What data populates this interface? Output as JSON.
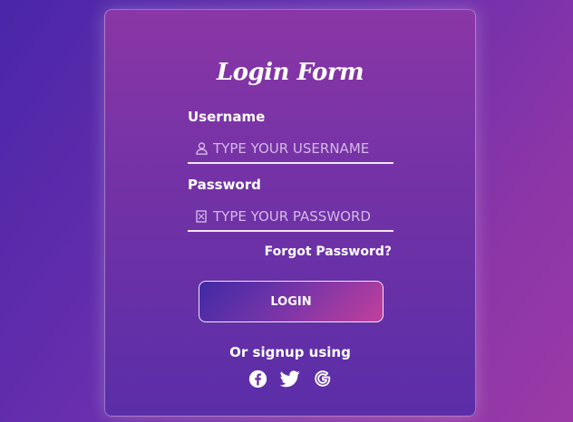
{
  "form": {
    "title": "Login Form",
    "username": {
      "label": "Username",
      "placeholder": "TYPE YOUR USERNAME",
      "value": "",
      "icon": "user-icon"
    },
    "password": {
      "label": "Password",
      "placeholder": "TYPE YOUR PASSWORD",
      "value": "",
      "icon": "lock-icon"
    },
    "forgot_label": "Forgot Password?",
    "login_label": "LOGIN",
    "signup_text": "Or signup using",
    "social": [
      "facebook-icon",
      "twitter-icon",
      "google-icon"
    ]
  },
  "colors": {
    "background_start": "#4a26a8",
    "background_end": "#9b3aa6",
    "card_top": "#8a36a6",
    "card_bottom": "#5a2ea8",
    "text": "#ffffff",
    "placeholder": "#d5b8e6"
  }
}
